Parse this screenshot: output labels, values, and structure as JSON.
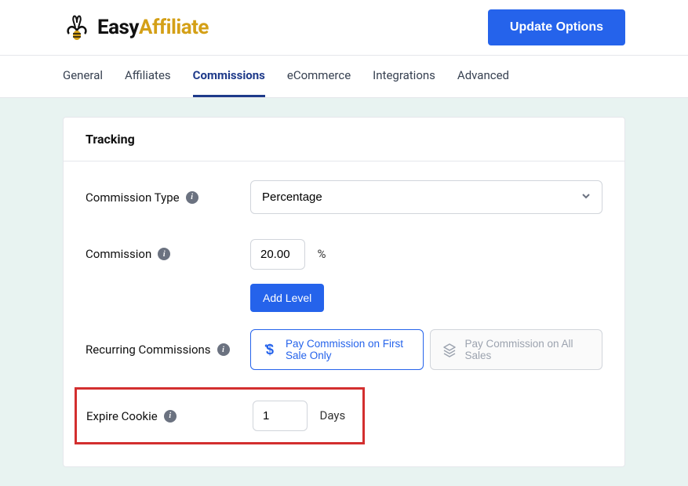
{
  "header": {
    "logo_text_1": "Easy",
    "logo_text_2": "Affiliate",
    "update_button": "Update Options"
  },
  "tabs": {
    "general": "General",
    "affiliates": "Affiliates",
    "commissions": "Commissions",
    "ecommerce": "eCommerce",
    "integrations": "Integrations",
    "advanced": "Advanced"
  },
  "card": {
    "title": "Tracking",
    "commission_type": {
      "label": "Commission Type",
      "value": "Percentage"
    },
    "commission": {
      "label": "Commission",
      "value": "20.00",
      "unit": "%",
      "add_level": "Add Level"
    },
    "recurring": {
      "label": "Recurring Commissions",
      "option_first": "Pay Commission on First Sale Only",
      "option_all": "Pay Commission on All Sales"
    },
    "expire_cookie": {
      "label": "Expire Cookie",
      "value": "1",
      "unit": "Days"
    }
  }
}
